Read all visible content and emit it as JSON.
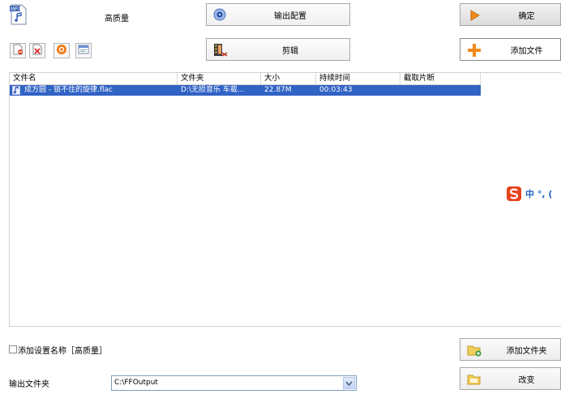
{
  "preset": {
    "icon": "mp3-file-icon",
    "label": "高质量"
  },
  "buttons": {
    "output_config": "输出配置",
    "confirm": "确定",
    "clip": "剪辑",
    "add_file": "添加文件",
    "add_folder": "添加文件夹",
    "change": "改变"
  },
  "list": {
    "columns": [
      "文件名",
      "文件夹",
      "大小",
      "持续时间",
      "截取片断"
    ],
    "rows": [
      {
        "name": "成方圆 - 锁不住的旋律.flac",
        "folder": "D:\\无损音乐 车载...",
        "size": "22.87M",
        "duration": "00:03:43",
        "clip": ""
      }
    ]
  },
  "add_setting_label": "添加设置名称［高质量］",
  "output_folder": {
    "label": "输出文件夹",
    "value": "C:\\FFOutput"
  },
  "ime": {
    "text": "中 °, ("
  },
  "colors": {
    "selection": "#3163c5",
    "accent_orange": "#f08a1c"
  }
}
